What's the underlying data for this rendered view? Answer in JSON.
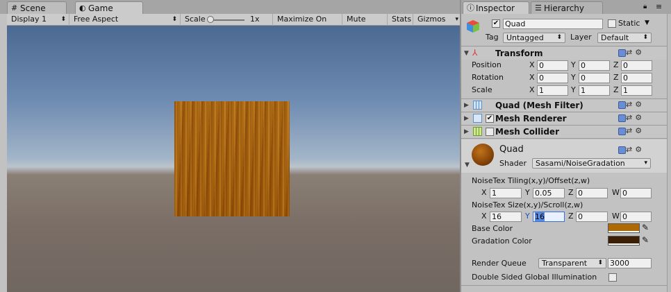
{
  "tabs": {
    "scene": "Scene",
    "game": "Game",
    "inspector": "Inspector",
    "hierarchy": "Hierarchy"
  },
  "game_toolbar": {
    "display": "Display 1",
    "aspect": "Free Aspect",
    "scale_label": "Scale",
    "scale_value": "1x",
    "scale_level": 0.0,
    "maximize": "Maximize On Play",
    "mute": "Mute Audio",
    "stats": "Stats",
    "gizmos": "Gizmos"
  },
  "object": {
    "active": true,
    "name": "Quad",
    "static_label": "Static",
    "static": false,
    "tag_label": "Tag",
    "tag_value": "Untagged",
    "layer_label": "Layer",
    "layer_value": "Default"
  },
  "transform": {
    "title": "Transform",
    "position": {
      "label": "Position",
      "x": "0",
      "y": "0",
      "z": "0"
    },
    "rotation": {
      "label": "Rotation",
      "x": "0",
      "y": "0",
      "z": "0"
    },
    "scale": {
      "label": "Scale",
      "x": "1",
      "y": "1",
      "z": "1"
    }
  },
  "axes": {
    "x": "X",
    "y": "Y",
    "z": "Z",
    "w": "W"
  },
  "components": {
    "mesh_filter": "Quad (Mesh Filter)",
    "mesh_renderer": "Mesh Renderer",
    "mesh_renderer_enabled": true,
    "mesh_collider": "Mesh Collider",
    "mesh_collider_enabled": false
  },
  "material": {
    "name": "Quad",
    "shader_label": "Shader",
    "shader_value": "Sasami/NoiseGradation",
    "tiling_label": "NoiseTex Tiling(x,y)/Offset(z,w)",
    "tiling": {
      "x": "1",
      "y": "0.05",
      "z": "0",
      "w": "0"
    },
    "size_label": "NoiseTex Size(x,y)/Scroll(z,w)",
    "size": {
      "x": "16",
      "y": "16",
      "z": "0",
      "w": "0"
    },
    "base_color_label": "Base Color",
    "base_color": "#b06a05",
    "gradation_color_label": "Gradation Color",
    "gradation_color": "#3d1f05",
    "render_queue_label": "Render Queue",
    "render_queue_mode": "Transparent",
    "render_queue_value": "3000",
    "double_sided_label": "Double Sided Global Illumination",
    "double_sided": false
  },
  "icons": {
    "scene": "hash-icon",
    "game": "pacman-icon",
    "inspector": "info-icon",
    "hierarchy": "list-icon",
    "lock": "lock-icon",
    "menu": "menu-icon"
  },
  "colors": {
    "panel": "#c2c2c2",
    "tab_bar": "#a5a5a5",
    "selection": "#3d6fd1"
  }
}
